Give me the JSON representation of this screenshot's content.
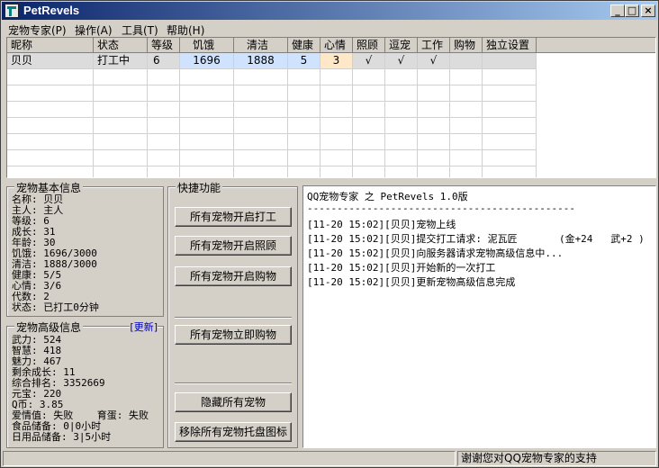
{
  "window": {
    "title": "PetRevels",
    "min_label": "_",
    "max_label": "□",
    "close_label": "×"
  },
  "menu": [
    "宠物专家(P)",
    "操作(A)",
    "工具(T)",
    "帮助(H)"
  ],
  "table": {
    "headers": [
      "昵称",
      "状态",
      "等级",
      "饥饿",
      "清洁",
      "健康",
      "心情",
      "照顾",
      "逗宠",
      "工作",
      "购物",
      "独立设置"
    ],
    "rows": [
      [
        "贝贝",
        "打工中",
        "6",
        "1696",
        "1888",
        "5",
        "3",
        "√",
        "√",
        "√",
        "",
        ""
      ]
    ]
  },
  "basic_info": {
    "label": "宠物基本信息",
    "lines": [
      "名称: 贝贝",
      "主人: 主人",
      "等级: 6",
      "成长: 31",
      "年龄: 30",
      "饥饿: 1696/3000",
      "清洁: 1888/3000",
      "健康: 5/5",
      "心情: 3/6",
      "代数: 2",
      "状态: 已打工0分钟"
    ]
  },
  "advanced_info": {
    "label": "宠物高级信息",
    "refresh_label": "[更新]",
    "lines": [
      "武力: 524",
      "智慧: 418",
      "魅力: 467",
      "剩余成长: 11",
      "综合排名: 3352669",
      "元宝: 220",
      "Q币: 3.85",
      "爱情值: 失败    育蛋: 失败",
      "食品储备: 0|0小时",
      "日用品储备: 3|5小时"
    ]
  },
  "quick": {
    "label": "快捷功能",
    "buttons": [
      "所有宠物开启打工",
      "所有宠物开启照顾",
      "所有宠物开启购物",
      "所有宠物立即购物",
      "隐藏所有宠物",
      "移除所有宠物托盘图标"
    ]
  },
  "log": {
    "header": "QQ宠物专家 之 PetRevels 1.0版",
    "divider": "---------------------------------------------",
    "lines": [
      "[11-20 15:02][贝贝]宠物上线",
      "[11-20 15:02][贝贝]提交打工请求: 泥瓦匠       (金+24   武+2 )",
      "[11-20 15:02][贝贝]向服务器请求宠物高级信息中...",
      "[11-20 15:02][贝贝]开始新的一次打工",
      "[11-20 15:02][贝贝]更新宠物高级信息完成"
    ]
  },
  "status": {
    "left": "",
    "right": "谢谢您对QQ宠物专家的支持"
  },
  "colors": {
    "titlebar_start": "#0a246a",
    "titlebar_end": "#a6caf0",
    "hunger_bg": "#cfe3ff",
    "health_bg": "#cfe3ff",
    "mood_bg": "#ffe8c8"
  }
}
